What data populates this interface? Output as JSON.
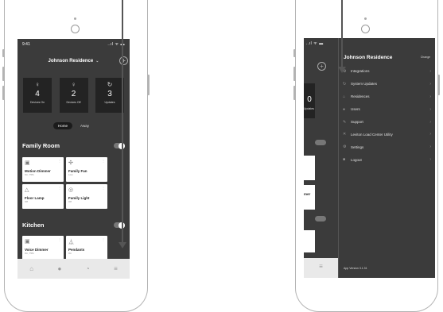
{
  "left_screen": {
    "time": "9:41",
    "signal": "..ıl ᯤ ▬",
    "residence": "Johnson Residence",
    "stats": [
      {
        "icon": "bulb-on",
        "glyph": "♀",
        "value": "4",
        "label": "Devices On"
      },
      {
        "icon": "bulb-off",
        "glyph": "♀",
        "value": "2",
        "label": "Devices Off"
      },
      {
        "icon": "refresh",
        "glyph": "↻",
        "value": "3",
        "label": "Updates"
      }
    ],
    "modes": [
      "Home",
      "Away"
    ],
    "rooms": [
      {
        "name": "Family Room",
        "devices": [
          {
            "name": "Motion Dimmer",
            "status": "On, 75%",
            "glyph": "▣"
          },
          {
            "name": "Family Fan",
            "status": "Low",
            "glyph": "✣"
          },
          {
            "name": "Floor Lamp",
            "status": "Off",
            "glyph": "△"
          },
          {
            "name": "Family Light",
            "status": "Off",
            "glyph": "◎"
          }
        ]
      },
      {
        "name": "Kitchen",
        "devices": [
          {
            "name": "Voice Dimmer",
            "status": "On, 75%",
            "glyph": "▣"
          },
          {
            "name": "Pendants",
            "status": "On",
            "glyph": "⏅"
          }
        ]
      }
    ],
    "tabs": [
      {
        "icon": "home",
        "glyph": "⌂"
      },
      {
        "icon": "scenes",
        "glyph": "●"
      },
      {
        "icon": "schedule",
        "glyph": "◔"
      },
      {
        "icon": "menu",
        "glyph": "≡"
      }
    ]
  },
  "right_screen": {
    "signal": "..ıl ᯤ ▬",
    "residence": "Johnson Residence",
    "change_label": "Change",
    "menu": [
      {
        "icon": "integrations",
        "glyph": "⚙",
        "label": "Integrations"
      },
      {
        "icon": "system-updates",
        "glyph": "↻",
        "label": "System Updates"
      },
      {
        "icon": "residences",
        "glyph": "⌂",
        "label": "Residences"
      },
      {
        "icon": "users",
        "glyph": "●",
        "label": "Users"
      },
      {
        "icon": "support",
        "glyph": "✎",
        "label": "Support"
      },
      {
        "icon": "load-center",
        "glyph": "✕",
        "label": "Leviton Load Center Utility"
      },
      {
        "icon": "settings",
        "glyph": "⚙",
        "label": "Settings"
      },
      {
        "icon": "logout",
        "glyph": "■",
        "label": "Logout"
      }
    ],
    "behind_panel": {
      "update_num": "0",
      "update_label": "Updates",
      "partial_device": "mer",
      "plus": "+"
    },
    "app_version": "App Version 3.1.31",
    "menu_glyph": "≡"
  },
  "colors": {
    "screen": "#3b3b3b",
    "tile": "#ffffff",
    "stat": "#232323"
  }
}
